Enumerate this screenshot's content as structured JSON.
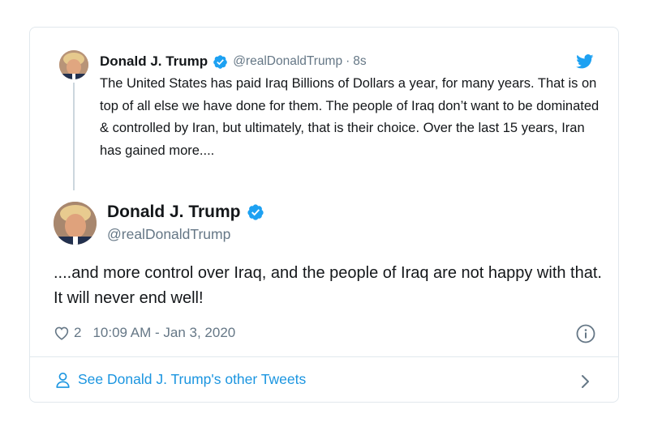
{
  "parent_tweet": {
    "author_name": "Donald J. Trump",
    "handle": "@realDonaldTrump",
    "separator": "·",
    "time": "8s",
    "text": "The United States has paid Iraq Billions of Dollars a year, for many years. That is on top of all else we have done for them. The people of Iraq don’t want to be dominated & controlled by Iran, but ultimately, that is their choice. Over the last 15 years, Iran has gained more...."
  },
  "main_tweet": {
    "author_name": "Donald J. Trump",
    "handle": "@realDonaldTrump",
    "text": "....and more control over Iraq, and the people of Iraq are not happy with that. It will never end well!",
    "like_count": "2",
    "timestamp": "10:09 AM - Jan 3, 2020"
  },
  "footer": {
    "link_label": "See Donald J. Trump's other Tweets"
  },
  "icons": {
    "verified": "verified-badge-icon",
    "twitter": "twitter-bird-icon",
    "like": "heart-icon",
    "info": "info-icon",
    "profile": "person-icon",
    "chevron": "chevron-right-icon"
  },
  "colors": {
    "twitter_blue": "#1da1f2",
    "link_blue": "#1b95e0",
    "secondary_text": "#657786",
    "border": "#e1e8ed"
  }
}
